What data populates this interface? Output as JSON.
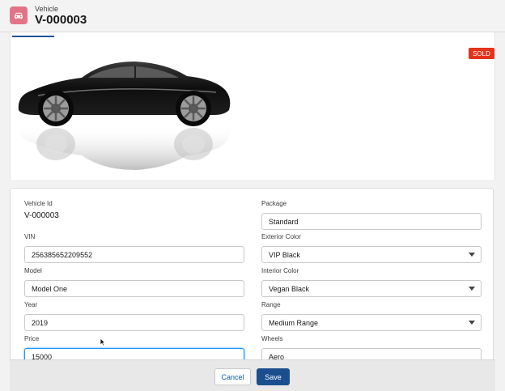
{
  "header": {
    "object_type": "Vehicle",
    "record_name": "V-000003",
    "icon": "car-icon",
    "icon_color": "#e27486"
  },
  "status_badge": {
    "label": "SOLD",
    "color": "#e4321b"
  },
  "image": {
    "subject": "black sports car with reflection"
  },
  "form": {
    "vehicle_id": {
      "label": "Vehicle Id",
      "value": "V-000003"
    },
    "vin": {
      "label": "VIN",
      "value": "256385652209552"
    },
    "model": {
      "label": "Model",
      "value": "Model One"
    },
    "year": {
      "label": "Year",
      "value": "2019"
    },
    "price": {
      "label": "Price",
      "value": "15000"
    },
    "package": {
      "label": "Package",
      "value": "Standard"
    },
    "exterior_color": {
      "label": "Exterior Color",
      "value": "VIP Black"
    },
    "interior_color": {
      "label": "Interior Color",
      "value": "Vegan Black"
    },
    "range": {
      "label": "Range",
      "value": "Medium Range"
    },
    "wheels": {
      "label": "Wheels",
      "value": "Aero"
    }
  },
  "footer": {
    "cancel_label": "Cancel",
    "save_label": "Save",
    "save_color": "#1b4e8f"
  }
}
